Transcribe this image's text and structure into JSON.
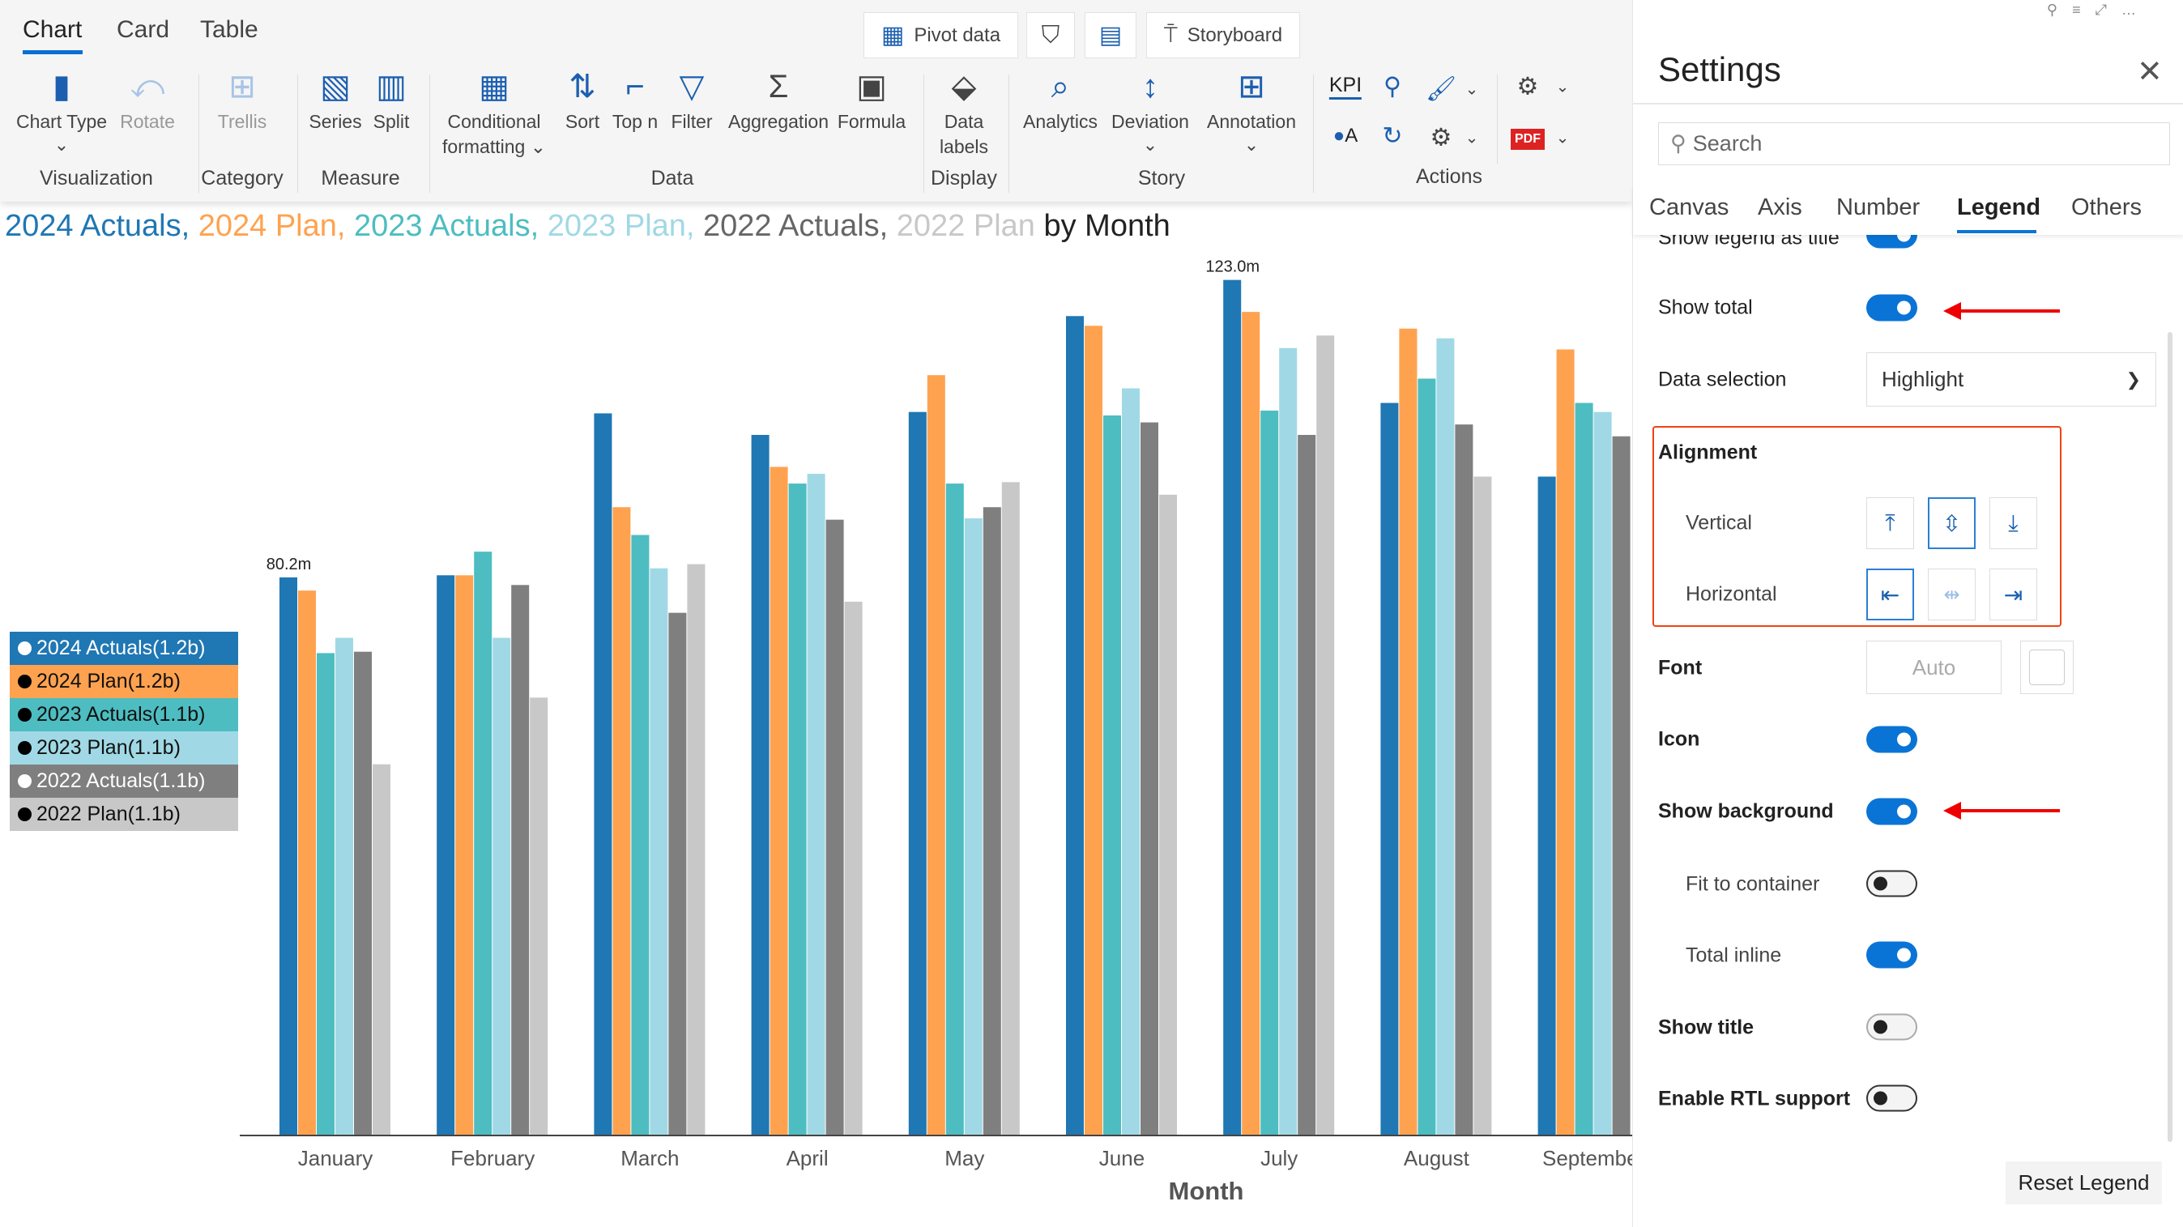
{
  "ribbon": {
    "tabs": [
      "Chart",
      "Card",
      "Table"
    ],
    "top_buttons": {
      "pivot": "Pivot data",
      "storyboard": "Storyboard"
    },
    "items": {
      "chart_type": "Chart Type",
      "rotate": "Rotate",
      "trellis": "Trellis",
      "series": "Series",
      "split": "Split",
      "conditional_1": "Conditional",
      "conditional_2": "formatting",
      "sort": "Sort",
      "topn": "Top n",
      "filter": "Filter",
      "aggregation": "Aggregation",
      "formula": "Formula",
      "data_labels_1": "Data",
      "data_labels_2": "labels",
      "analytics": "Analytics",
      "deviation": "Deviation",
      "annotation": "Annotation",
      "kpi": "KPI",
      "oa": "A"
    },
    "groups": [
      "Visualization",
      "Category",
      "Measure",
      "Data",
      "Display",
      "Story",
      "Actions"
    ]
  },
  "title": {
    "parts": [
      "2024 Actuals,",
      "2024 Plan,",
      "2023 Actuals,",
      "2023 Plan,",
      "2022 Actuals,",
      "2022 Plan"
    ],
    "suffix": "by Month"
  },
  "legend": {
    "items": [
      "2024 Actuals(1.2b)",
      "2024 Plan(1.2b)",
      "2023 Actuals(1.1b)",
      "2023 Plan(1.1b)",
      "2022 Actuals(1.1b)",
      "2022 Plan(1.1b)"
    ]
  },
  "chart_data": {
    "type": "bar",
    "xlabel": "Month",
    "categories": [
      "January",
      "February",
      "March",
      "April",
      "May",
      "June",
      "July",
      "August",
      "September"
    ],
    "series": [
      {
        "name": "2024 Actuals",
        "color": "#1f77b4",
        "values": [
          80.2,
          80.5,
          103.8,
          100.7,
          104.0,
          117.8,
          123.0,
          105.3,
          94.7
        ]
      },
      {
        "name": "2024 Plan",
        "color": "#ffa24f",
        "values": [
          78.3,
          80.5,
          90.3,
          96.1,
          109.3,
          116.4,
          118.4,
          116.0,
          113.0
        ]
      },
      {
        "name": "2023 Actuals",
        "color": "#4dbdc1",
        "values": [
          69.3,
          83.9,
          86.3,
          93.7,
          93.7,
          103.5,
          104.2,
          108.8,
          105.3
        ]
      },
      {
        "name": "2023 Plan",
        "color": "#a0d9e5",
        "values": [
          71.5,
          71.5,
          81.5,
          95.1,
          88.7,
          107.4,
          113.2,
          114.6,
          104.0
        ]
      },
      {
        "name": "2022 Actuals",
        "color": "#7f7f7f",
        "values": [
          69.5,
          79.1,
          75.1,
          88.5,
          90.3,
          102.5,
          100.7,
          102.2,
          100.5
        ]
      },
      {
        "name": "2022 Plan",
        "color": "#c8c8c8",
        "values": [
          53.3,
          62.9,
          82.1,
          76.7,
          93.9,
          92.1,
          115.0,
          94.7,
          null
        ]
      }
    ],
    "data_labels": [
      {
        "category": "January",
        "series": "2024 Actuals",
        "text": "80.2m"
      },
      {
        "category": "July",
        "series": "2024 Actuals",
        "text": "123.0m"
      }
    ],
    "ylim": [
      0,
      140
    ],
    "grid": false,
    "legend_position": "left"
  },
  "settings": {
    "title": "Settings",
    "search_placeholder": "Search",
    "tabs": [
      "Canvas",
      "Axis",
      "Number",
      "Legend",
      "Others"
    ],
    "active_tab": "Legend",
    "show_legend_as_title": {
      "label": "Show legend as title",
      "on": true
    },
    "show_total": {
      "label": "Show total",
      "on": true
    },
    "data_selection": {
      "label": "Data selection",
      "value": "Highlight"
    },
    "alignment": {
      "label": "Alignment",
      "vertical": "Vertical",
      "horizontal": "Horizontal",
      "vertical_selected": "middle",
      "horizontal_selected": "left"
    },
    "font": {
      "label": "Font",
      "value": "Auto"
    },
    "icon": {
      "label": "Icon",
      "on": true
    },
    "show_background": {
      "label": "Show background",
      "on": true
    },
    "fit_to_container": {
      "label": "Fit to container",
      "on": false
    },
    "total_inline": {
      "label": "Total inline",
      "on": true
    },
    "show_title": {
      "label": "Show title",
      "on": false
    },
    "enable_rtl": {
      "label": "Enable RTL support",
      "on": false
    },
    "reset_label": "Reset Legend"
  },
  "colors": {
    "accent": "#0a74d6",
    "annotation": "#e00000"
  }
}
